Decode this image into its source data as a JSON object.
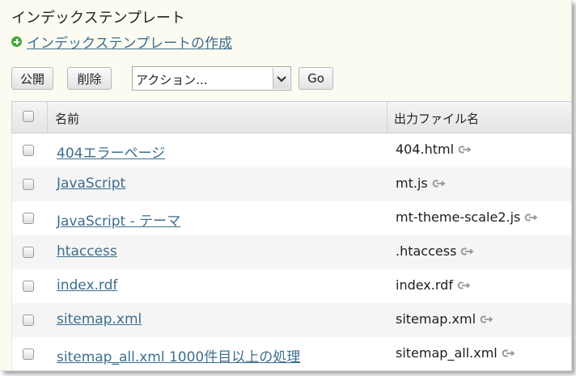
{
  "page": {
    "title": "インデックステンプレート",
    "create_link": "インデックステンプレートの作成"
  },
  "toolbar": {
    "publish_label": "公開",
    "delete_label": "削除",
    "action_select": "アクション...",
    "go_label": "Go"
  },
  "table": {
    "headers": {
      "name": "名前",
      "output_file": "出力ファイル名"
    },
    "rows": [
      {
        "name": "404エラーページ",
        "output": "404.html"
      },
      {
        "name": "JavaScript",
        "output": "mt.js"
      },
      {
        "name": "JavaScript - テーマ",
        "output": "mt-theme-scale2.js"
      },
      {
        "name": "htaccess",
        "output": ".htaccess"
      },
      {
        "name": "index.rdf",
        "output": "index.rdf"
      },
      {
        "name": "sitemap.xml",
        "output": "sitemap.xml"
      },
      {
        "name": "sitemap_all.xml 1000件目以上の処理",
        "output": "sitemap_all.xml"
      }
    ]
  },
  "icons": {
    "create": "plus-circle-icon",
    "dropdown": "chevron-down-icon",
    "output_link": "external-link-icon"
  },
  "colors": {
    "background": "#fbfbf2",
    "link": "#3d6e8f",
    "plus_icon": "#49a83c",
    "row_alt": "#f5f5f5",
    "header_bg": "#e9e9e9"
  }
}
